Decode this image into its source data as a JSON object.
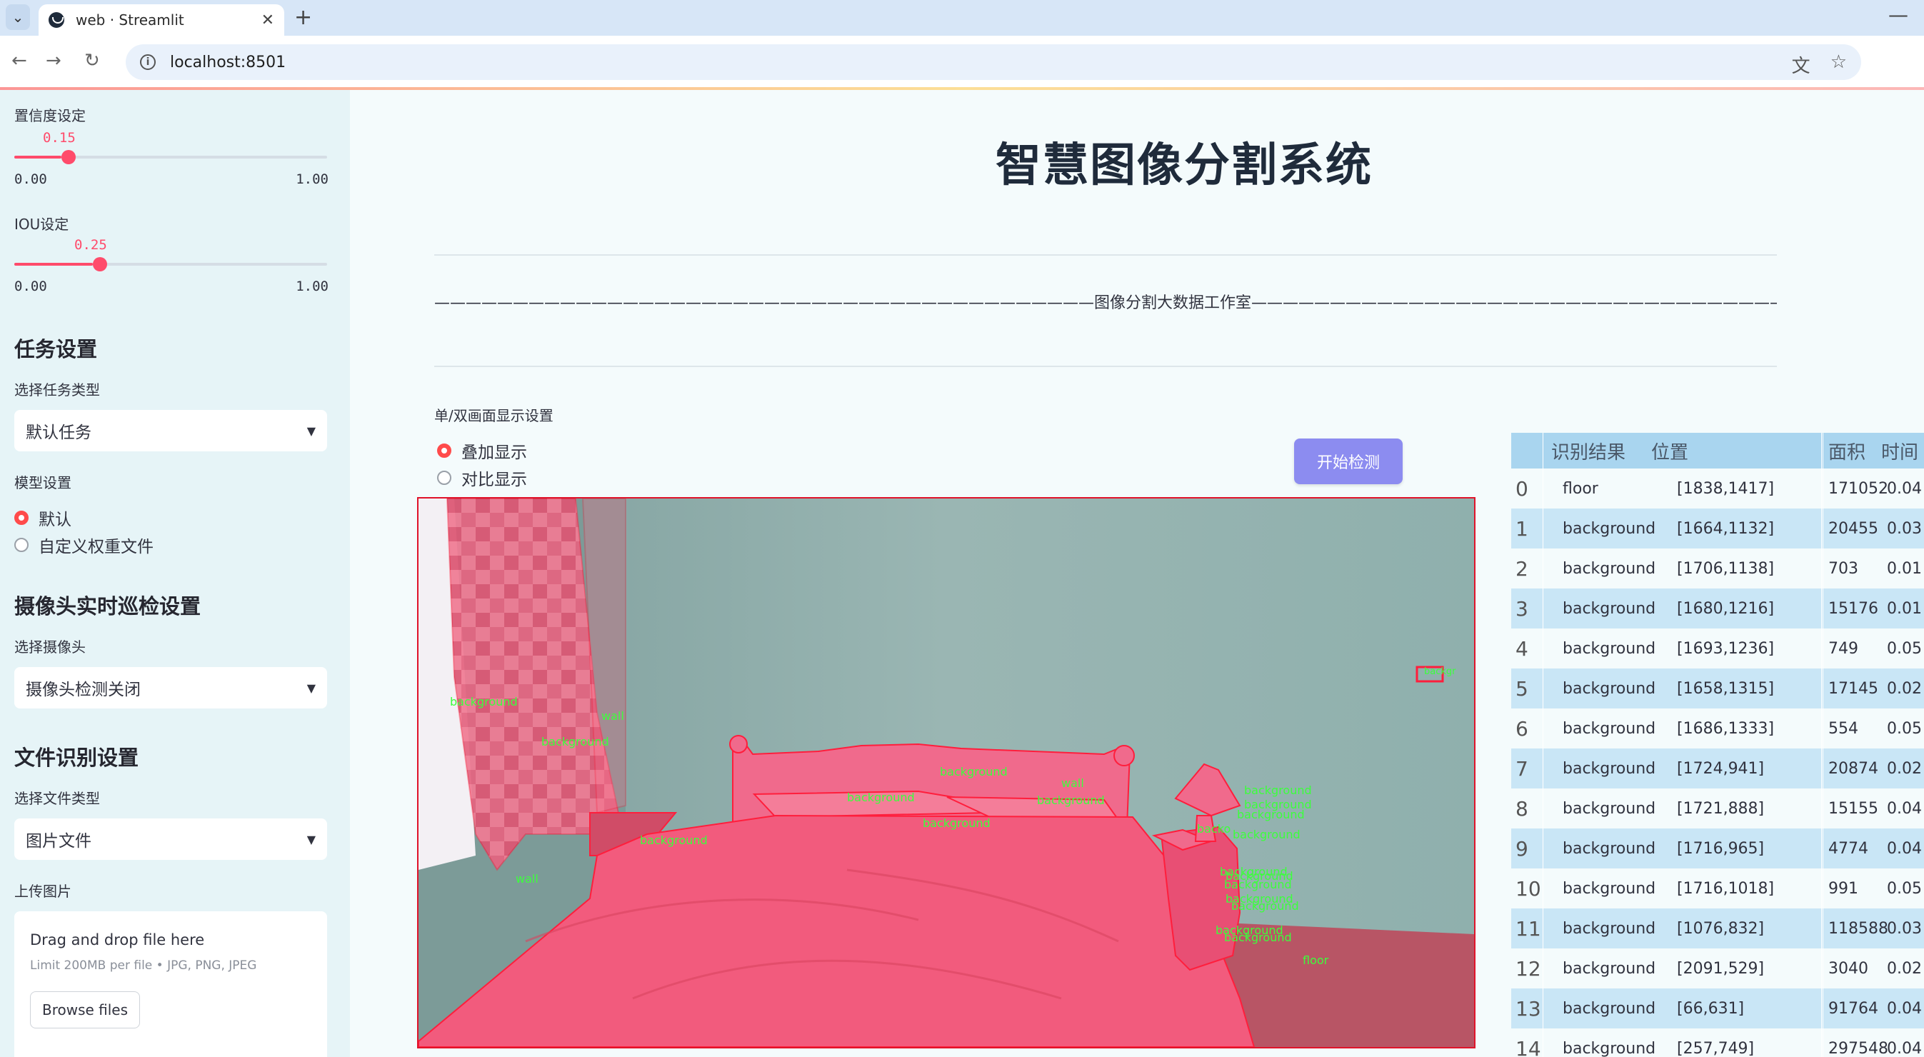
{
  "browser": {
    "tab_title": "web · Streamlit",
    "url": "localhost:8501"
  },
  "sidebar": {
    "confidence": {
      "label": "置信度设定",
      "value": "0.15",
      "min": "0.00",
      "max": "1.00",
      "fraction": 0.15
    },
    "iou": {
      "label": "IOU设定",
      "value": "0.25",
      "min": "0.00",
      "max": "1.00",
      "fraction": 0.25
    },
    "task_heading": "任务设置",
    "task_type_label": "选择任务类型",
    "task_type_value": "默认任务",
    "model_label": "模型设置",
    "model_options": [
      "默认",
      "自定义权重文件"
    ],
    "camera_heading": "摄像头实时巡检设置",
    "camera_label": "选择摄像头",
    "camera_value": "摄像头检测关闭",
    "file_heading": "文件识别设置",
    "file_type_label": "选择文件类型",
    "file_type_value": "图片文件",
    "upload_label": "上传图片",
    "upload_title": "Drag and drop file here",
    "upload_limit": "Limit 200MB per file • JPG, PNG, JPEG",
    "browse_label": "Browse files"
  },
  "main": {
    "title": "智慧图像分割系统",
    "subtitle": "——————————————————————————————————————————图像分割大数据工作室——————————————————————————————————————————",
    "display_label": "单/双画面显示设置",
    "display_options": [
      "叠加显示",
      "对比显示"
    ],
    "start_button": "开始检测"
  },
  "image_labels": {
    "background": "background",
    "wall": "wall",
    "floor": "floor",
    "partial": "backgr",
    "partial2": "backo"
  },
  "table": {
    "headers": [
      "识别结果",
      "位置",
      "面积",
      "时间"
    ],
    "rows": [
      {
        "idx": "0",
        "result": "floor",
        "pos": "[1838,1417]",
        "area": "171052",
        "time": "0.04"
      },
      {
        "idx": "1",
        "result": "background",
        "pos": "[1664,1132]",
        "area": "20455",
        "time": "0.03"
      },
      {
        "idx": "2",
        "result": "background",
        "pos": "[1706,1138]",
        "area": "703",
        "time": "0.01"
      },
      {
        "idx": "3",
        "result": "background",
        "pos": "[1680,1216]",
        "area": "15176",
        "time": "0.01"
      },
      {
        "idx": "4",
        "result": "background",
        "pos": "[1693,1236]",
        "area": "749",
        "time": "0.05"
      },
      {
        "idx": "5",
        "result": "background",
        "pos": "[1658,1315]",
        "area": "17145",
        "time": "0.02"
      },
      {
        "idx": "6",
        "result": "background",
        "pos": "[1686,1333]",
        "area": "554",
        "time": "0.05"
      },
      {
        "idx": "7",
        "result": "background",
        "pos": "[1724,941]",
        "area": "20874",
        "time": "0.02"
      },
      {
        "idx": "8",
        "result": "background",
        "pos": "[1721,888]",
        "area": "15155",
        "time": "0.04"
      },
      {
        "idx": "9",
        "result": "background",
        "pos": "[1716,965]",
        "area": "4774",
        "time": "0.04"
      },
      {
        "idx": "10",
        "result": "background",
        "pos": "[1716,1018]",
        "area": "991",
        "time": "0.05"
      },
      {
        "idx": "11",
        "result": "background",
        "pos": "[1076,832]",
        "area": "118588",
        "time": "0.03"
      },
      {
        "idx": "12",
        "result": "background",
        "pos": "[2091,529]",
        "area": "3040",
        "time": "0.02"
      },
      {
        "idx": "13",
        "result": "background",
        "pos": "[66,631]",
        "area": "91764",
        "time": "0.04"
      },
      {
        "idx": "14",
        "result": "background",
        "pos": "[257,749]",
        "area": "297548",
        "time": "0.04"
      }
    ]
  }
}
